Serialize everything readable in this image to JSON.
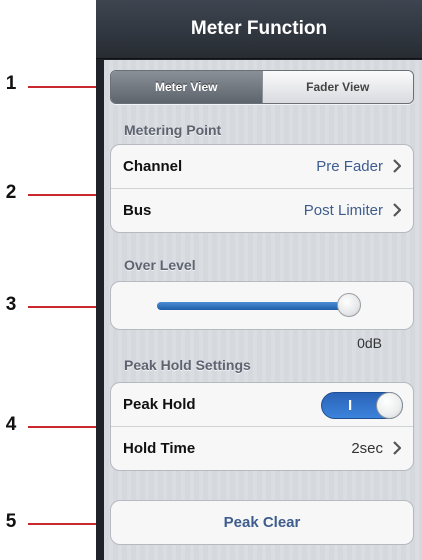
{
  "callouts": [
    "1",
    "2",
    "3",
    "4",
    "5"
  ],
  "window": {
    "title": "Meter Function"
  },
  "view_toggle": {
    "options": [
      "Meter View",
      "Fader View"
    ],
    "selected": "Meter View"
  },
  "metering_point": {
    "header": "Metering Point",
    "rows": [
      {
        "label": "Channel",
        "value": "Pre Fader"
      },
      {
        "label": "Bus",
        "value": "Post Limiter"
      }
    ]
  },
  "over_level": {
    "header": "Over Level",
    "value_text": "0dB",
    "slider_fraction": 0.98
  },
  "peak_hold": {
    "header": "Peak Hold Settings",
    "toggle_label": "Peak Hold",
    "toggle_state_text": "I",
    "toggle_on": true,
    "hold_time_label": "Hold Time",
    "hold_time_value": "2sec"
  },
  "peak_clear": {
    "label": "Peak Clear"
  },
  "colors": {
    "accent_blue": "#2a64b8",
    "callout_line": "#c8282e",
    "value_text": "#3e5d8e"
  }
}
